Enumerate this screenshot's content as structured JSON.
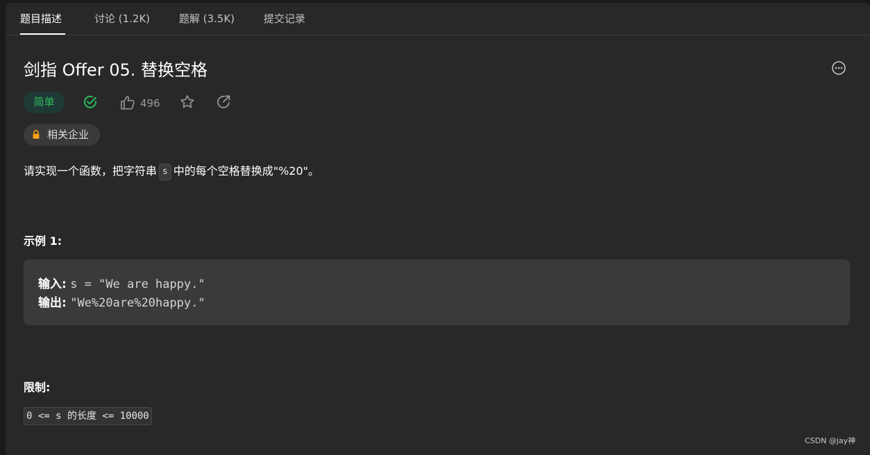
{
  "tabs": [
    {
      "label": "题目描述",
      "active": true
    },
    {
      "label": "讨论 (1.2K)",
      "active": false
    },
    {
      "label": "题解 (3.5K)",
      "active": false
    },
    {
      "label": "提交记录",
      "active": false
    }
  ],
  "problem": {
    "title": "剑指 Offer 05. 替换空格",
    "difficulty": "简单",
    "likes": "496",
    "company_label": "相关企业",
    "description_before": "请实现一个函数，把字符串",
    "description_code": "s",
    "description_after": "中的每个空格替换成\"%20\"。"
  },
  "example": {
    "heading": "示例 1:",
    "input_label": "输入:",
    "input_value": "s = \"We are happy.\"",
    "output_label": "输出:",
    "output_value": "\"We%20are%20happy.\""
  },
  "constraints": {
    "heading": "限制:",
    "text": "0 <= s 的长度 <= 10000"
  },
  "watermark": "CSDN @jay神",
  "icons": {
    "solved": "check-circle-icon",
    "like": "thumbs-up-icon",
    "favorite": "star-icon",
    "share": "share-icon",
    "more": "more-horizontal-icon",
    "lock": "lock-icon"
  },
  "colors": {
    "easy": "#2cbb5d",
    "lock": "#ffa116",
    "background": "#282828"
  }
}
